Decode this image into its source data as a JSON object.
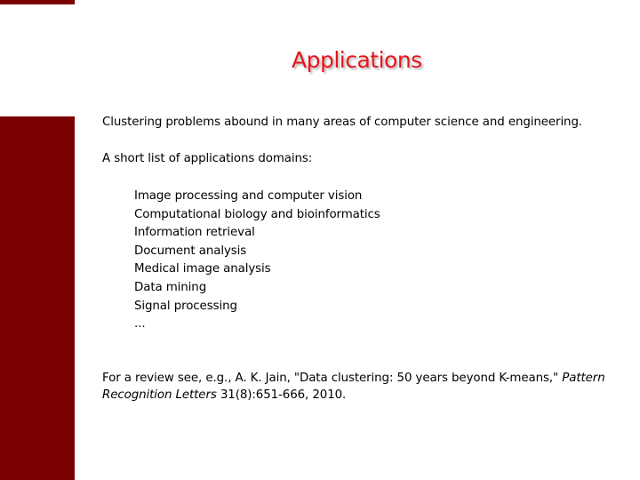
{
  "slide": {
    "title": "Applications",
    "intro": "Clustering problems abound in many areas of computer science and engineering.",
    "list_heading": "A short list of applications domains:",
    "domains": [
      "Image processing and computer vision",
      "Computational biology and bioinformatics",
      "Information retrieval",
      "Document analysis",
      "Medical image analysis",
      "Data mining",
      "Signal processing",
      "..."
    ],
    "reference": {
      "prefix": "For a review see, e.g., A. K. Jain, \"Data clustering: 50 years beyond K-means,\" ",
      "journal": "Pattern Recognition Letters",
      "suffix": " 31(8):651-666, 2010."
    }
  },
  "colors": {
    "accent_bar": "#7b0000",
    "title": "#e8141c"
  }
}
